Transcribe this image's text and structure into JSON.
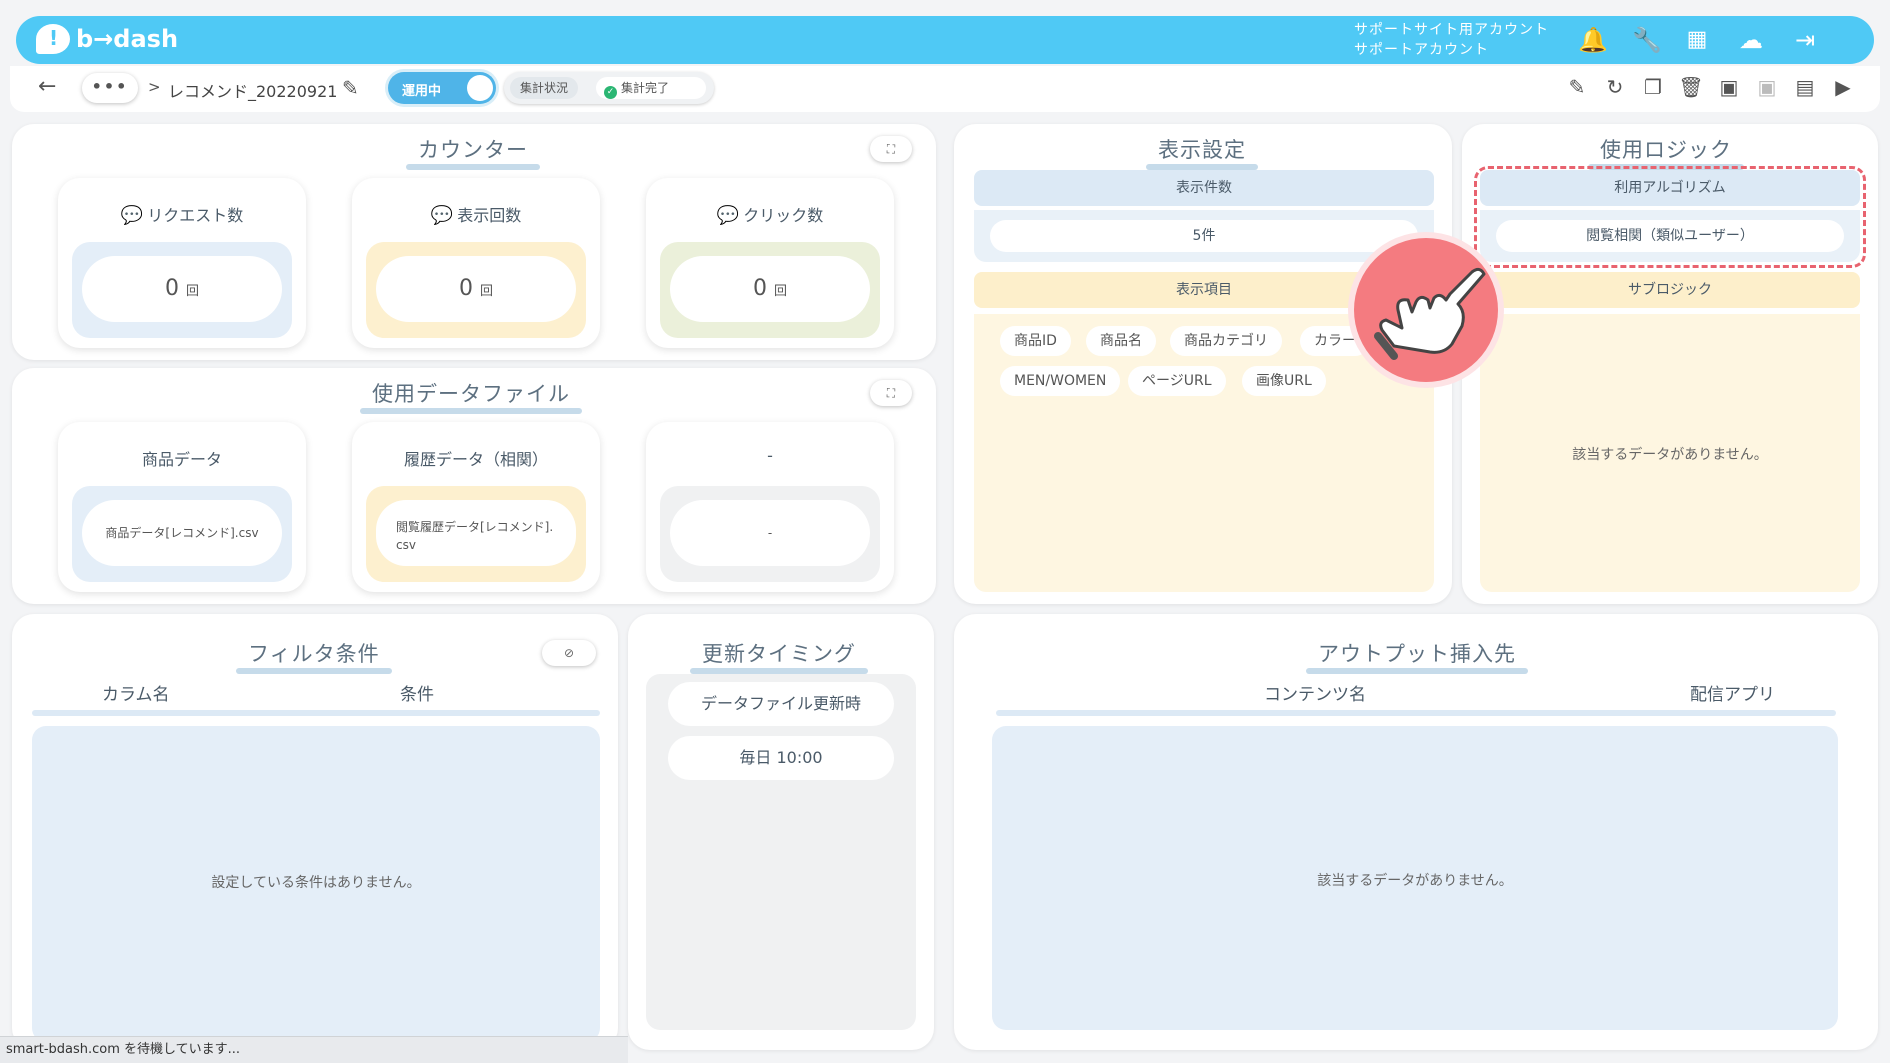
{
  "header": {
    "logo_text": "b→dash",
    "account_line1": "サポートサイト用アカウント",
    "account_line2": "サポートアカウント",
    "icons": [
      "bell-icon",
      "wrench-icon",
      "grid-icon",
      "chat-bot-icon",
      "logout-icon"
    ]
  },
  "subbar": {
    "back_icon": "arrow-left-icon",
    "more_label": "•••",
    "separator": ">",
    "title": "レコメンド_20220921",
    "status_label": "運用中",
    "agg_label": "集計状況",
    "agg_status": "集計完了",
    "tools": [
      "edit-icon",
      "history-icon",
      "copy-icon",
      "trash-icon",
      "archive-icon",
      "archive-disabled-icon",
      "document-icon",
      "play-icon"
    ]
  },
  "counter": {
    "title": "カウンター",
    "items": [
      {
        "label": "リクエスト数",
        "value": "0",
        "unit": "回",
        "bg": "#e4eef8"
      },
      {
        "label": "表示回数",
        "value": "0",
        "unit": "回",
        "bg": "#fdf0cf"
      },
      {
        "label": "クリック数",
        "value": "0",
        "unit": "回",
        "bg": "#ebf0da"
      }
    ]
  },
  "datafiles": {
    "title": "使用データファイル",
    "items": [
      {
        "label": "商品データ",
        "value": "商品データ[レコメンド].csv"
      },
      {
        "label": "履歴データ（相関）",
        "value": "閲覧履歴データ[レコメンド].csv"
      },
      {
        "label": "-",
        "value": "-"
      }
    ]
  },
  "display": {
    "title": "表示設定",
    "count_header": "表示件数",
    "count_value": "5件",
    "items_header": "表示項目",
    "chips": [
      "商品ID",
      "商品名",
      "商品カテゴリ",
      "カラー",
      "MEN/WOMEN",
      "ページURL",
      "画像URL"
    ]
  },
  "logic": {
    "title": "使用ロジック",
    "algo_header": "利用アルゴリズム",
    "algo_value": "閲覧相関（類似ユーザー）",
    "sub_header": "サブロジック",
    "sub_empty": "該当するデータがありません。"
  },
  "filter": {
    "title": "フィルタ条件",
    "col1": "カラム名",
    "col2": "条件",
    "empty": "設定している条件はありません。"
  },
  "timing": {
    "title": "更新タイミング",
    "row1": "データファイル更新時",
    "row2": "毎日 10:00"
  },
  "output": {
    "title": "アウトプット挿入先",
    "col1": "コンテンツ名",
    "col2": "配信アプリ",
    "empty": "該当するデータがありません。"
  },
  "statusbar": {
    "text": "smart-bdash.com を待機しています..."
  },
  "colors": {
    "brand": "#4fc9f5",
    "highlight": "#e8636f"
  }
}
